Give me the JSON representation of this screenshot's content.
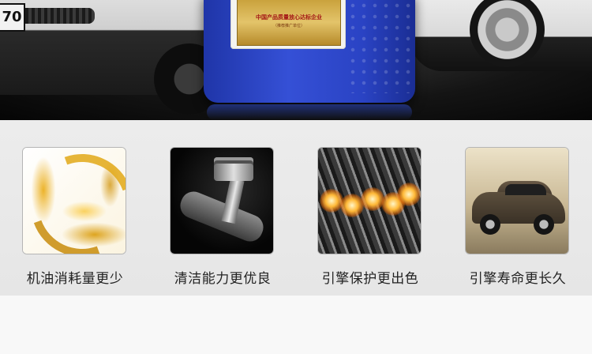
{
  "hero": {
    "plate_text": "70",
    "certificate": {
      "title": "中国产品质量放心达标企业",
      "subtitle": "（推荐推广单位）"
    }
  },
  "features": [
    {
      "label": "机油消耗量更少",
      "icon": "oil-splash-image"
    },
    {
      "label": "清洁能力更优良",
      "icon": "piston-image"
    },
    {
      "label": "引擎保护更出色",
      "icon": "engine-cylinders-image"
    },
    {
      "label": "引擎寿命更长久",
      "icon": "suv-car-image"
    }
  ],
  "colors": {
    "product_blue": "#2a43c4",
    "oil_gold": "#e2a816",
    "background": "#ececec"
  }
}
